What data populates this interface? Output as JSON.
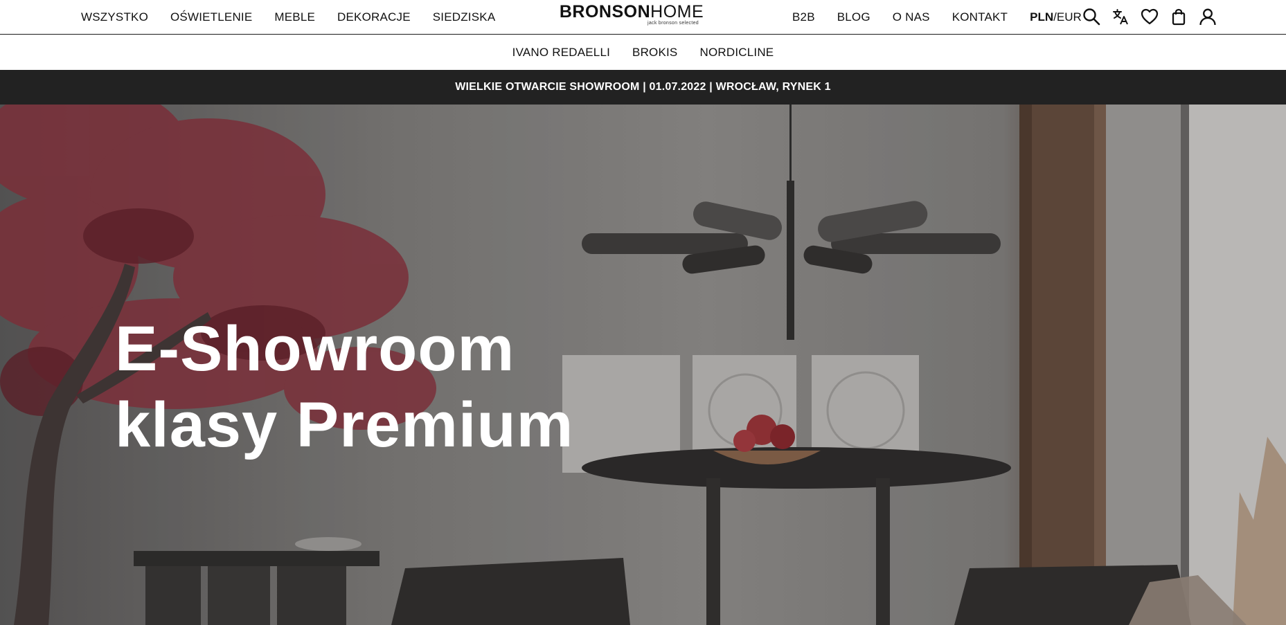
{
  "header": {
    "left_nav": [
      "WSZYSTKO",
      "OŚWIETLENIE",
      "MEBLE",
      "DEKORACJE",
      "SIEDZISKA"
    ],
    "logo": {
      "bold": "BRONSON",
      "light": "HOME",
      "tagline": "jack bronson selected"
    },
    "right_nav": [
      "B2B",
      "BLOG",
      "O NAS",
      "KONTAKT"
    ],
    "currency": {
      "active": "PLN",
      "separator": "/",
      "other": "EUR"
    },
    "icons": [
      "search-icon",
      "translate-icon",
      "heart-icon",
      "bag-icon",
      "user-icon"
    ]
  },
  "subnav": [
    "IVANO REDAELLI",
    "BROKIS",
    "NORDICLINE"
  ],
  "announcement": "WIELKIE OTWARCIE SHOWROOM | 01.07.2022 | WROCŁAW, RYNEK 1",
  "hero": {
    "title_line1": "E-Showroom",
    "title_line2": "klasy Premium"
  },
  "colors": {
    "announcement_bg": "#222222",
    "text": "#111111",
    "hero_text": "#ffffff"
  }
}
